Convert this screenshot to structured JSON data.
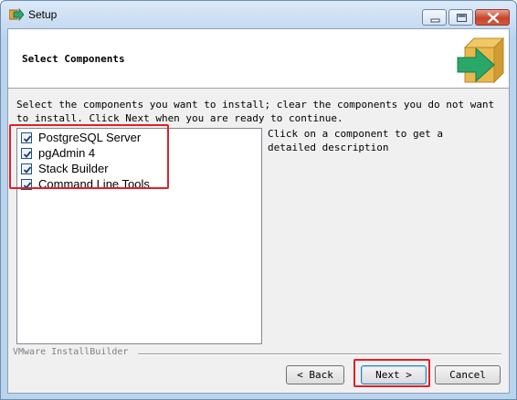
{
  "window": {
    "title": "Setup",
    "icon": "setup-arrow-icon"
  },
  "header": {
    "title": "Select Components",
    "logo_icon": "box-arrow-icon"
  },
  "instructions": "Select the components you want to install; clear the components you do not want to install. Click Next when you are ready to continue.",
  "components": [
    {
      "label": "PostgreSQL Server",
      "checked": true
    },
    {
      "label": "pgAdmin 4",
      "checked": true
    },
    {
      "label": "Stack Builder",
      "checked": true
    },
    {
      "label": "Command Line Tools",
      "checked": true
    }
  ],
  "description_hint": "Click on a component to get a detailed description",
  "brand": "VMware InstallBuilder",
  "buttons": {
    "back": "< Back",
    "next": "Next >",
    "cancel": "Cancel"
  },
  "colors": {
    "highlight": "#e21f26",
    "logo_box": "#e9b84a",
    "logo_arrow": "#2aa86a"
  }
}
